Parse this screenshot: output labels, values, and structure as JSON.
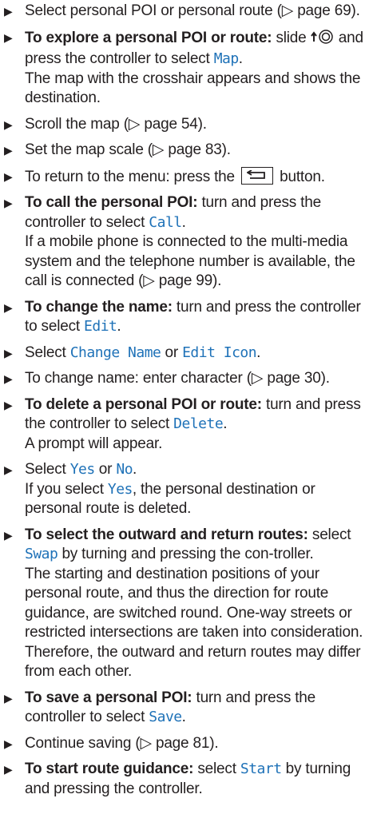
{
  "items": [
    {
      "plain": "Select personal POI or personal route (▷ page 69)."
    },
    {
      "bold": "To explore a personal POI or route:",
      "pre": " slide ",
      "mid": " and press the controller to select ",
      "kw": "Map",
      "post": ".",
      "cont": "The map with the crosshair appears and shows the destination."
    },
    {
      "plain": "Scroll the map (▷ page 54)."
    },
    {
      "plain": "Set the map scale (▷ page 83)."
    },
    {
      "pre": "To return to the menu: press the ",
      "post": " button."
    },
    {
      "bold": "To call the personal POI:",
      "pre": " turn and press the controller to select ",
      "kw": "Call",
      "post": ".",
      "cont": "If a mobile phone is connected to the multi-media system and the telephone number is available, the call is connected (▷ page 99)."
    },
    {
      "bold": "To change the name:",
      "pre": " turn and press the controller to select ",
      "kw": "Edit",
      "post": "."
    },
    {
      "pre": "Select ",
      "kw1": "Change Name",
      "mid": " or ",
      "kw2": "Edit Icon",
      "post": "."
    },
    {
      "plain": "To change name: enter character (▷ page 30)."
    },
    {
      "bold": "To delete a personal POI or route:",
      "pre": " turn and press the controller to select ",
      "kw": "Delete",
      "post": ".",
      "cont": "A prompt will appear."
    },
    {
      "pre": "Select ",
      "kw1": "Yes",
      "mid": " or ",
      "kw2": "No",
      "post": ".",
      "cont_pre": "If you select ",
      "cont_kw": "Yes",
      "cont_post": ", the personal destination or personal route is deleted."
    },
    {
      "bold": "To select the outward and return routes:",
      "pre": " select ",
      "kw": "Swap",
      "post": " by turning and pressing the con-troller.",
      "cont": "The starting and destination positions of your personal route, and thus the direction for route guidance, are switched round. One-way streets or restricted intersections are taken into consideration. Therefore, the outward and return routes may differ from each other."
    },
    {
      "bold": "To save a personal POI:",
      "pre": " turn and press the controller to select ",
      "kw": "Save",
      "post": "."
    },
    {
      "plain": "Continue saving (▷ page 81)."
    },
    {
      "bold": "To start route guidance:",
      "pre": " select ",
      "kw": "Start",
      "post": " by turning and pressing the controller."
    }
  ],
  "icons": {
    "bullet": "right-triangle-bullet",
    "controller": "controller-slide-up-icon",
    "back": "back-button-icon"
  },
  "colors": {
    "text": "#231f20",
    "keyword": "#1f72b8"
  }
}
